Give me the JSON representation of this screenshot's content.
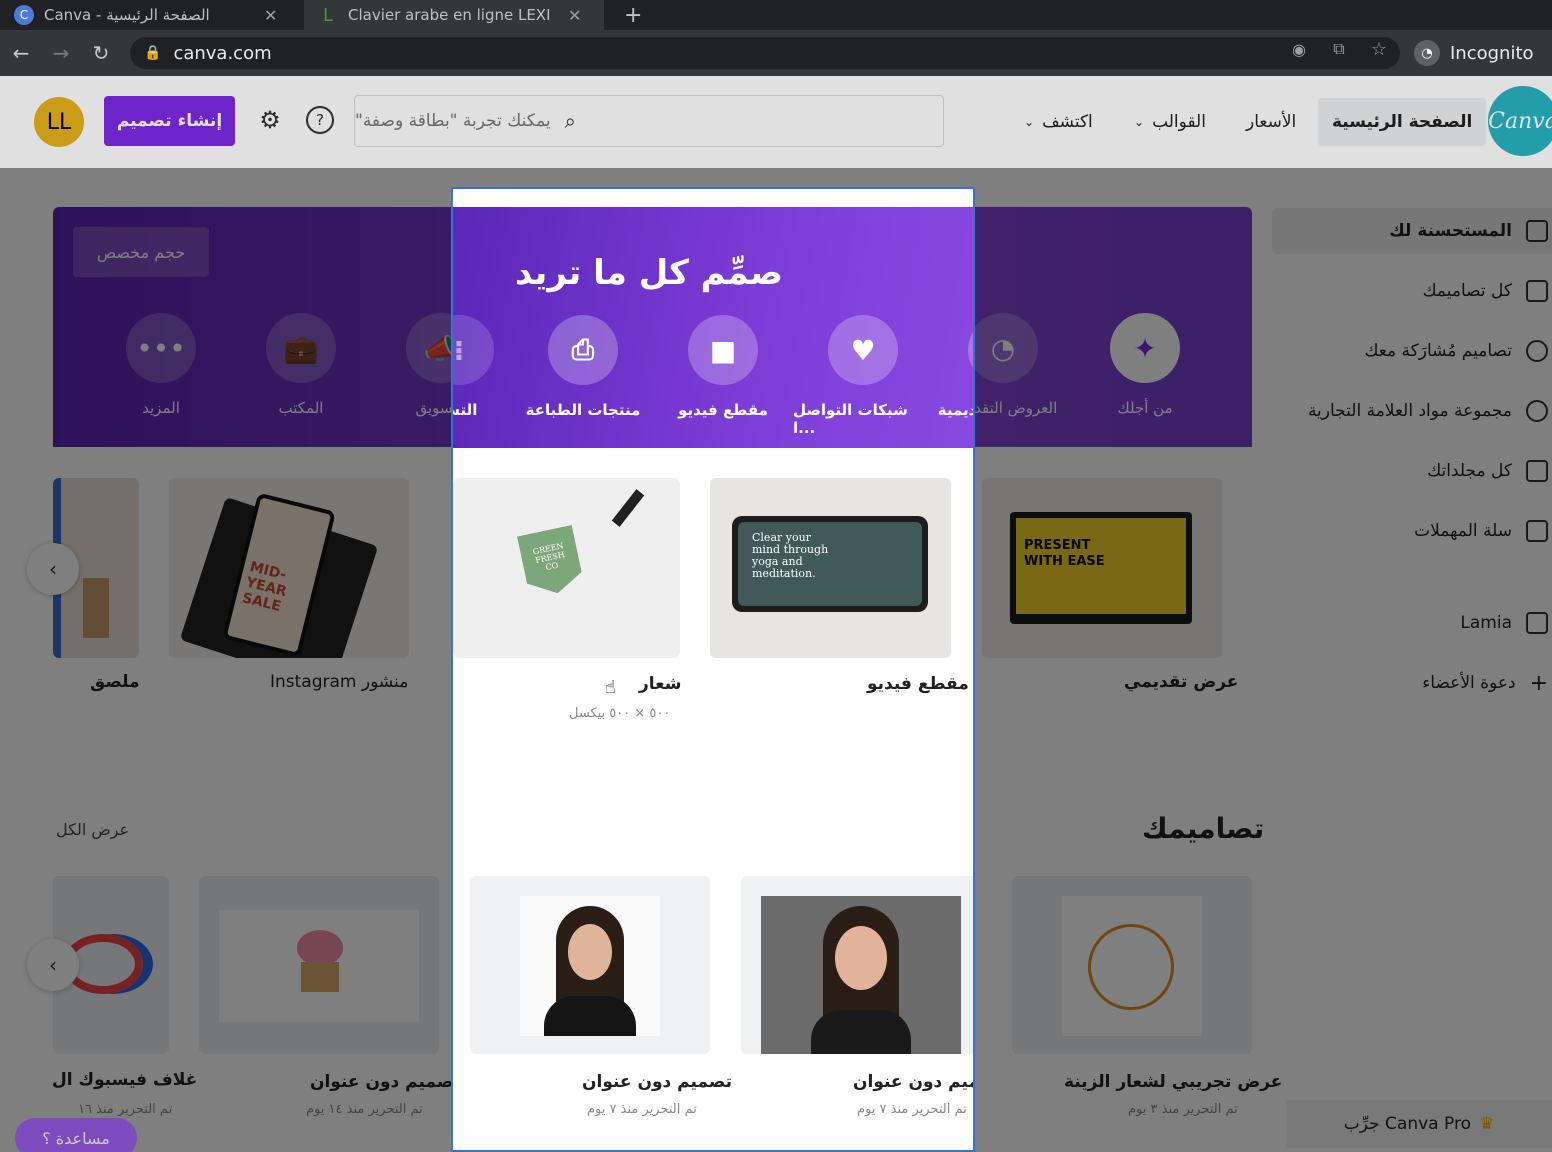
{
  "browser": {
    "tabs": [
      {
        "title": "Canva - الصفحة الرئيسية",
        "favicon": "C",
        "color": "#4a7bd8"
      },
      {
        "title": "Clavier arabe en ligne LEXI",
        "favicon": "L",
        "color": "#3b9c3b"
      }
    ],
    "new_tab": "+",
    "url": "canva.com",
    "incognito_label": "Incognito"
  },
  "header": {
    "avatar_initials": "LL",
    "create_label": "إنشاء تصميم",
    "search_placeholder": "يمكنك تجربة \"بطاقة وصفة\"",
    "nav": {
      "discover": "اكتشف",
      "templates": "القوالب",
      "pricing": "الأسعار",
      "home": "الصفحة الرئيسية"
    },
    "logo": "Canva"
  },
  "sidebar": {
    "items": [
      {
        "label": "المستحسنة لك"
      },
      {
        "label": "كل تصاميمك"
      },
      {
        "label": "تصاميم مُشارَكة معك"
      },
      {
        "label": "مجموعة مواد العلامة التجارية"
      },
      {
        "label": "كل مجلداتك"
      },
      {
        "label": "سلة المهملات"
      },
      {
        "label": "Lamia"
      },
      {
        "label": "دعوة الأعضاء"
      }
    ],
    "try_pro": "جرِّب Canva Pro"
  },
  "banner": {
    "custom_size": "حجم مخصص",
    "categories": [
      {
        "label": "المزيد",
        "icon": "more-icon"
      },
      {
        "label": "المكتب",
        "icon": "briefcase-icon"
      },
      {
        "label": "التسويق",
        "icon": "megaphone-icon"
      },
      {
        "label": "العروض التقديمية",
        "icon": "presentation-icon"
      },
      {
        "label": "من أجلك",
        "icon": "sparkle-icon"
      }
    ]
  },
  "suggestions": [
    {
      "title": "ملصق"
    },
    {
      "title": "منشور Instagram"
    },
    {
      "title": "عرض تقديمي"
    }
  ],
  "your_designs": {
    "heading": "تصاميمك",
    "see_all": "عرض الكل",
    "items": [
      {
        "title": "غلاف فيسبوك ال",
        "sub": "تم التحرير منذ ١٦"
      },
      {
        "title": "تصميم دون عنوان",
        "sub": "تم التحرير منذ ١٤ يوم"
      },
      {
        "title": "عرض تجريبي لشعار الزينة",
        "sub": "تم التحرير منذ ٣ يوم"
      }
    ]
  },
  "modal": {
    "title": "صمِّم كل ما تريد",
    "categories": [
      {
        "label": "منتجات الطباعة",
        "icon": "print-icon"
      },
      {
        "label": "مقطع فيديو",
        "icon": "video-icon"
      },
      {
        "label": "شبكات التواصل ا...",
        "icon": "heart-chat-icon"
      },
      {
        "label": "العروض التقديمية",
        "icon": "presentation-icon"
      }
    ],
    "partial_left": "التسويق",
    "suggestions": [
      {
        "title": "شعار",
        "sub": "٥٠٠ × ٥٠٠ بيكسل"
      },
      {
        "title": "مقطع فيديو",
        "sub": ""
      }
    ],
    "designs": [
      {
        "title": "تصميم دون عنوان",
        "sub": "تم التحرير منذ ٧ يوم"
      },
      {
        "title": "تصميم دون عنوان",
        "sub": "تم التحرير منذ ٧ يوم"
      }
    ]
  },
  "help_button": "مساعدة ؟",
  "thumb_text": {
    "sale": "MID-YEAR SALE",
    "present": "PRESENT WITH EASE",
    "yoga": "Clear your mind through yoga and meditation.",
    "logo": "GREEN FRESH CO"
  }
}
